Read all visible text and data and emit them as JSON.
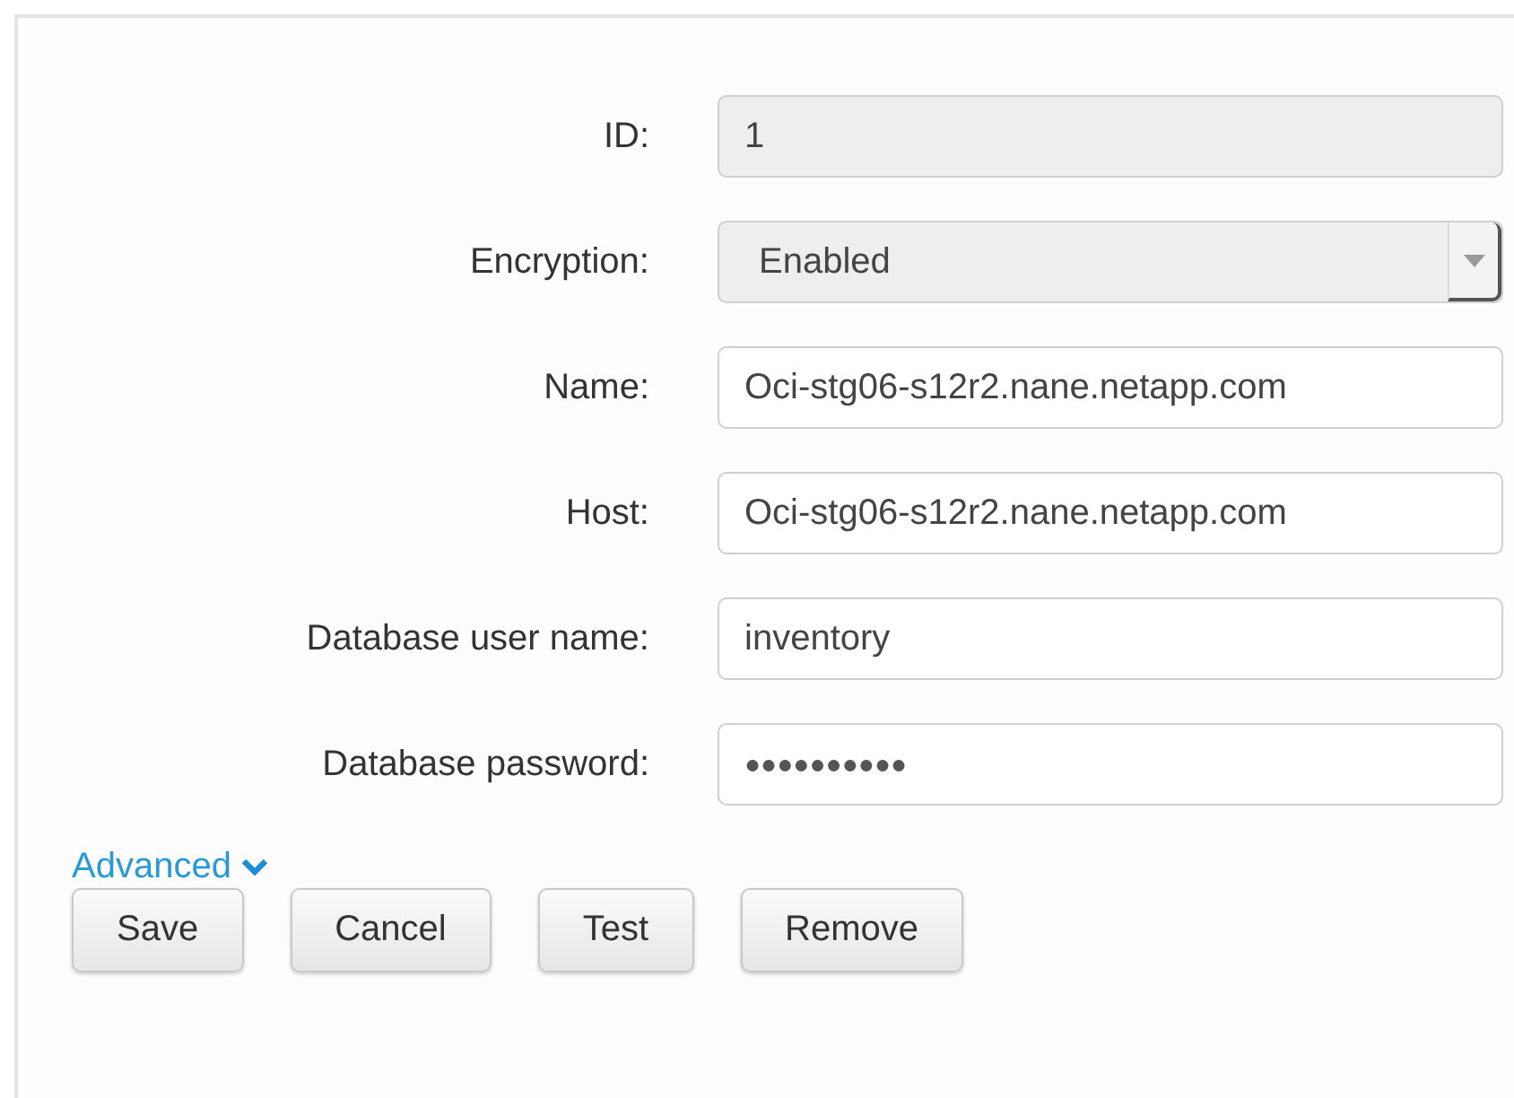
{
  "fields": [
    {
      "label": "ID:",
      "kind": "text",
      "value": "1",
      "disabled": true
    },
    {
      "label": "Encryption:",
      "kind": "select",
      "value": "Enabled",
      "disabled": true
    },
    {
      "label": "Name:",
      "kind": "text",
      "value": "Oci-stg06-s12r2.nane.netapp.com",
      "disabled": false
    },
    {
      "label": "Host:",
      "kind": "text",
      "value": "Oci-stg06-s12r2.nane.netapp.com",
      "disabled": false
    },
    {
      "label": "Database user name:",
      "kind": "text",
      "value": "inventory",
      "disabled": false
    },
    {
      "label": "Database password:",
      "kind": "password",
      "value": "●●●●●●●●●●",
      "disabled": false
    }
  ],
  "advanced": {
    "label": "Advanced",
    "expanded": false
  },
  "buttons": [
    "Save",
    "Cancel",
    "Test",
    "Remove"
  ]
}
